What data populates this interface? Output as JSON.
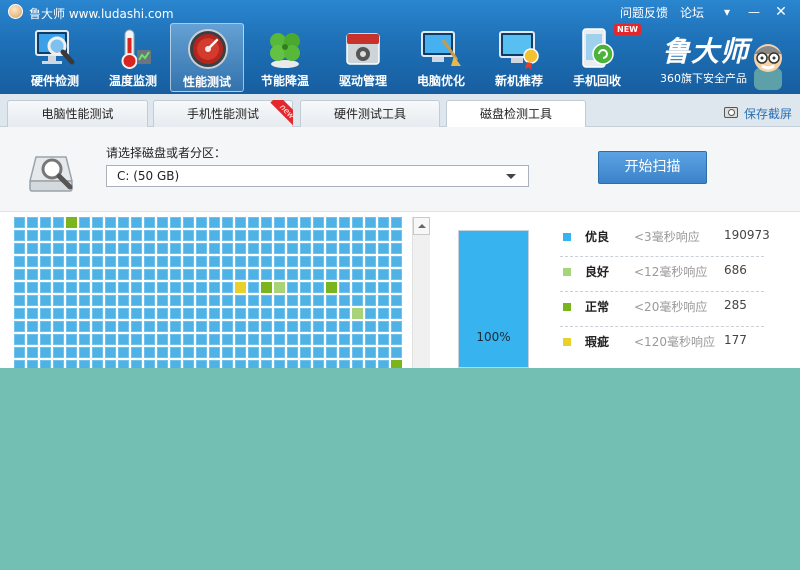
{
  "window": {
    "title": "鲁大师 www.ludashi.com",
    "links": [
      "问题反馈",
      "论坛"
    ],
    "controls": [
      "menu-icon",
      "minimize-icon",
      "close-icon"
    ]
  },
  "nav": {
    "items": [
      {
        "label": "硬件检测",
        "icon": "monitor-magnifier-icon"
      },
      {
        "label": "温度监测",
        "icon": "thermometer-icon"
      },
      {
        "label": "性能测试",
        "icon": "speedometer-icon",
        "active": true
      },
      {
        "label": "节能降温",
        "icon": "clover-icon"
      },
      {
        "label": "驱动管理",
        "icon": "driver-box-icon"
      },
      {
        "label": "电脑优化",
        "icon": "broom-monitor-icon"
      },
      {
        "label": "新机推荐",
        "icon": "monitor-medal-icon"
      },
      {
        "label": "手机回收",
        "icon": "phone-recycle-icon"
      }
    ],
    "new_badge": "NEW"
  },
  "brand": {
    "name": "鲁大师",
    "subtitle": "360旗下安全产品"
  },
  "tabs": [
    {
      "label": "电脑性能测试",
      "active": false
    },
    {
      "label": "手机性能测试",
      "active": false,
      "badge": "new"
    },
    {
      "label": "硬件测试工具",
      "active": false
    },
    {
      "label": "磁盘检测工具",
      "active": true
    }
  ],
  "save_screenshot": "保存截屏",
  "disk": {
    "select_label": "请选择磁盘或者分区：",
    "selected": "C:  (50 GB)",
    "scan_button": "开始扫描"
  },
  "progress": {
    "label": "100%",
    "fraction": 1.0
  },
  "legend": [
    {
      "name": "优良",
      "desc": "<3毫秒响应",
      "count": "190973",
      "color": "#37b3ef"
    },
    {
      "name": "良好",
      "desc": "<12毫秒响应",
      "count": "686",
      "color": "#a7d37a"
    },
    {
      "name": "正常",
      "desc": "<20毫秒响应",
      "count": "285",
      "color": "#7ab51d"
    },
    {
      "name": "瑕疵",
      "desc": "<120毫秒响应",
      "count": "177",
      "color": "#e8d12a"
    }
  ],
  "grid": {
    "colors": {
      "good": "#4fb2e6",
      "fine": "#a7d37a",
      "normal": "#7ab51d",
      "flaw": "#e8d12a"
    },
    "special_blocks": [
      {
        "row": 0,
        "col": 4,
        "status": "normal"
      },
      {
        "row": 5,
        "col": 17,
        "status": "flaw"
      },
      {
        "row": 5,
        "col": 19,
        "status": "normal"
      },
      {
        "row": 5,
        "col": 20,
        "status": "fine"
      },
      {
        "row": 5,
        "col": 24,
        "status": "normal"
      },
      {
        "row": 7,
        "col": 26,
        "status": "fine"
      },
      {
        "row": 11,
        "col": 29,
        "status": "normal"
      }
    ]
  }
}
